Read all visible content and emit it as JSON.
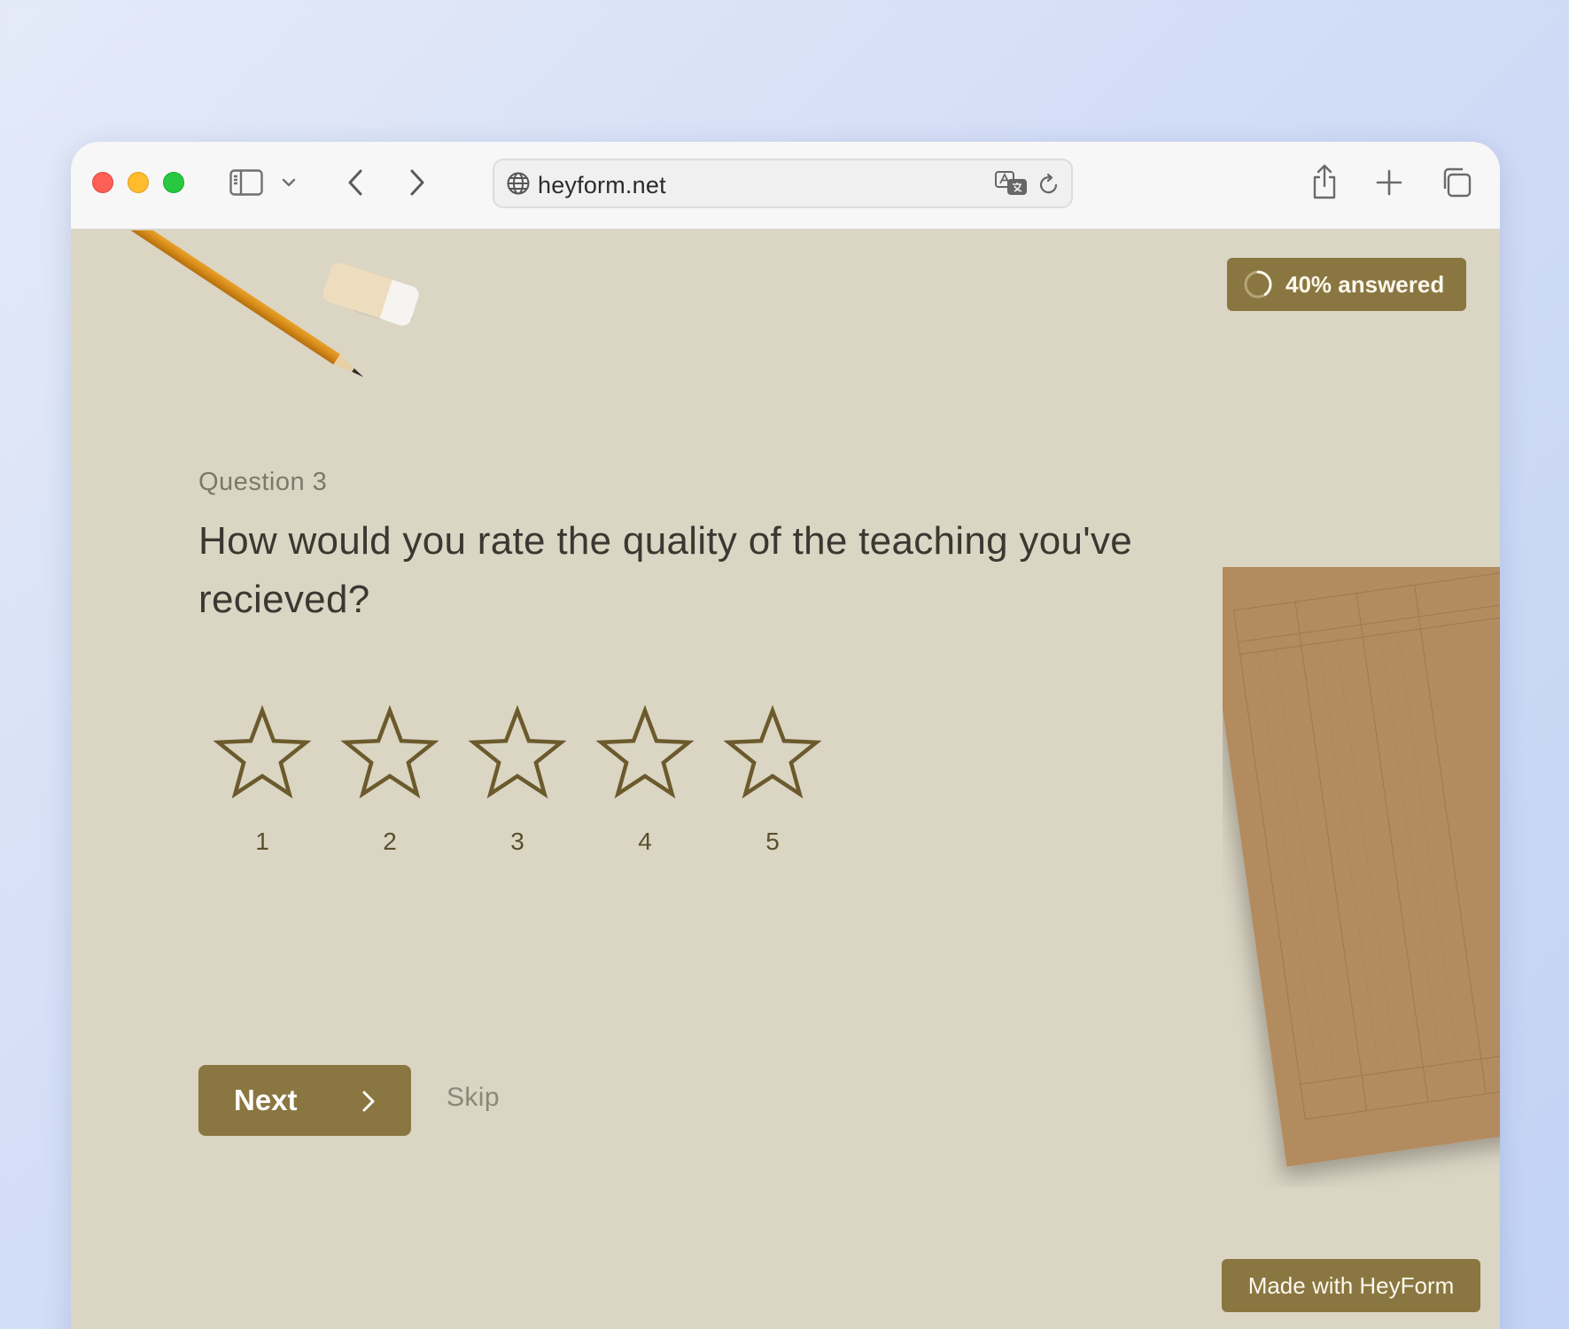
{
  "browser": {
    "url": "heyform.net"
  },
  "form": {
    "progress_text": "40% answered",
    "progress_value": 0.4,
    "question_number": "Question 3",
    "question_text": "How would you rate the quality of the teaching you've recieved?",
    "rating": {
      "max": 5,
      "selected": 0,
      "options": [
        "1",
        "2",
        "3",
        "4",
        "5"
      ]
    },
    "next_label": "Next",
    "skip_label": "Skip",
    "branding": "Made with HeyForm"
  },
  "colors": {
    "accent": "#8a7640",
    "background": "#dbd5c4",
    "star_outline": "#6b5a2c",
    "text_primary": "#3a3831",
    "text_muted": "#7d786b"
  },
  "icons": {
    "sidebar": "sidebar-toggle-icon",
    "back": "chevron-left-icon",
    "forward": "chevron-right-icon",
    "site": "globe-icon",
    "translate": "translate-icon",
    "reload": "reload-icon",
    "share": "share-icon",
    "new_tab": "plus-icon",
    "tabs": "tab-overview-icon"
  }
}
